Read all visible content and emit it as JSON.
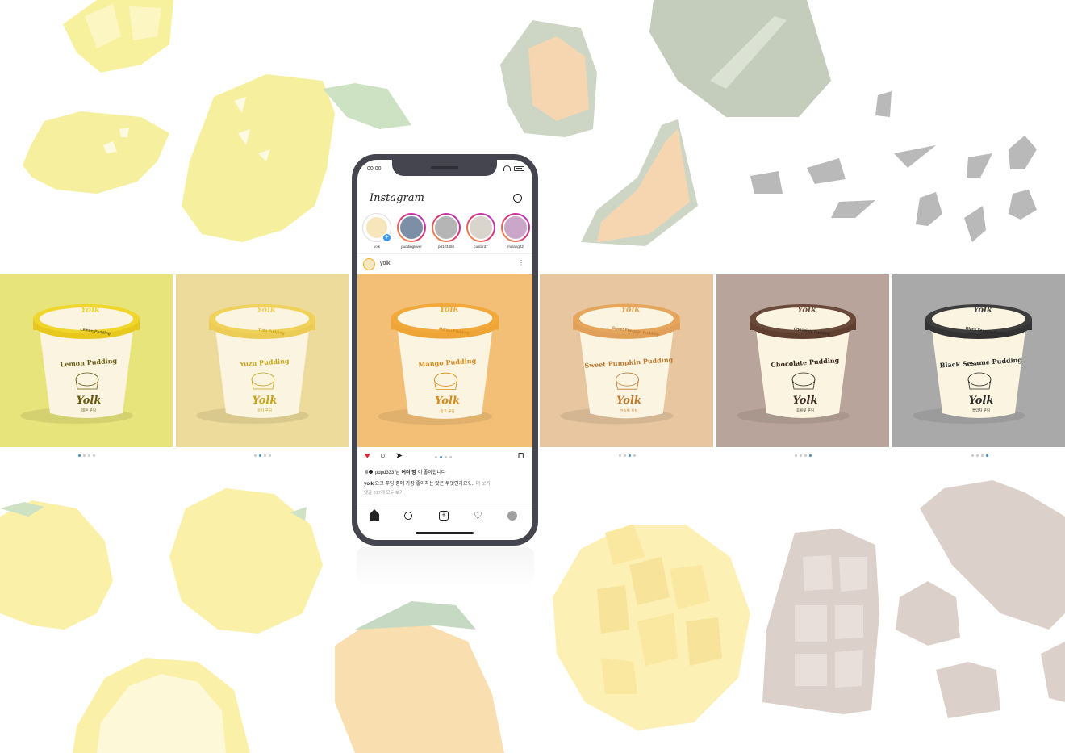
{
  "colors": {
    "lemon": "#e6e47a",
    "yuzu": "#ecdb9a",
    "mango": "#f3bf77",
    "pumpkin": "#e7c6a0",
    "chocolate": "#b8a49a",
    "sesame": "#a9a9a9",
    "story_gradient": [
      "#f5a33a",
      "#e1306c",
      "#b02fd0"
    ],
    "dot_active": "#3a8fd6",
    "like_red": "#e0242e",
    "phone_frame": "#45454f"
  },
  "products": [
    {
      "id": "lemon",
      "brand": "Yolk",
      "name": "Lemon Pudding",
      "lid_text": "Lemon Pudding",
      "korean": "레몬 푸딩",
      "bg": "#e6e47a",
      "lid": "#f0d52a",
      "band": "#e9c81d",
      "text_color": "#6a5a10",
      "active_dot": 0
    },
    {
      "id": "yuzu",
      "brand": "Yolk",
      "name": "Yuzu Pudding",
      "lid_text": "Yuzu Pudding",
      "korean": "유자 푸딩",
      "bg": "#ecdb9a",
      "lid": "#f0d15a",
      "band": "#eccc55",
      "text_color": "#c9a21a",
      "active_dot": 1
    },
    {
      "id": "mango",
      "brand": "Yolk",
      "name": "Mango Pudding",
      "lid_text": "Mango Pudding",
      "korean": "망고 푸딩",
      "bg": "#f3bf77",
      "lid": "#f2a83a",
      "band": "#eea535",
      "text_color": "#d98a1a",
      "active_dot": 1
    },
    {
      "id": "pumpkin",
      "brand": "Yolk",
      "name": "Sweet Pumpkin Pudding",
      "lid_text": "Sweet Pumpkin Pudding",
      "korean": "단호박 푸딩",
      "bg": "#e7c6a0",
      "lid": "#e5a65c",
      "band": "#e0a05a",
      "text_color": "#c07a30",
      "active_dot": 2
    },
    {
      "id": "chocolate",
      "brand": "Yolk",
      "name": "Chocolate Pudding",
      "lid_text": "Chocolate Pudding",
      "korean": "초콜릿 푸딩",
      "bg": "#b8a49a",
      "lid": "#6a4a3a",
      "band": "#5e3f30",
      "text_color": "#3a2820",
      "active_dot": 3
    },
    {
      "id": "sesame",
      "brand": "Yolk",
      "name": "Black Sesame Pudding",
      "lid_text": "Black Sesame Pudding",
      "korean": "흑임자 푸딩",
      "bg": "#a9a9a9",
      "lid": "#3d3d3d",
      "band": "#333333",
      "text_color": "#2a2a2a",
      "active_dot": 3
    }
  ],
  "phone": {
    "status_time": "00:00",
    "app_name": "Instagram",
    "stories": [
      {
        "name": "yolk",
        "own": true,
        "bg": "#f7e6bb"
      },
      {
        "name": "puddinglover",
        "own": false,
        "bg": "#7d8fa6"
      },
      {
        "name": "pd123456",
        "own": false,
        "bg": "#b5b5b5"
      },
      {
        "name": "custard7",
        "own": false,
        "bg": "#d9d5cc"
      },
      {
        "name": "malang22",
        "own": false,
        "bg": "#caa7c8"
      }
    ],
    "post": {
      "username": "yolk",
      "more": "⋮",
      "liked_by_prefix": "pdpd333 님 ",
      "liked_by_bold": "여러 명",
      "liked_by_suffix": "이 좋아합니다",
      "caption_user": "yolk",
      "caption_text": " 요크 푸딩 중에 가장 좋아하는 맛은 무엇인가요?...",
      "caption_more": " 더 보기",
      "comments": "댓글 817개 모두 보기"
    }
  }
}
